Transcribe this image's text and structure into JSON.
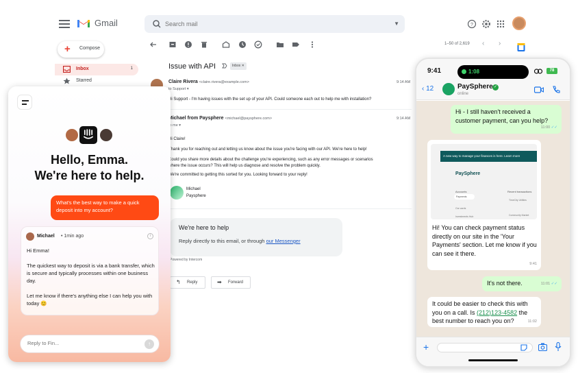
{
  "gmail": {
    "brand": "Gmail",
    "search_placeholder": "Search mail",
    "compose_label": "Compose",
    "nav": [
      {
        "label": "Inbox",
        "count": "1"
      },
      {
        "label": "Starred",
        "count": ""
      }
    ],
    "pager": "1–50 of 2,619",
    "subject": "Issue with API",
    "label_badge": "Inbox ✕",
    "messages": [
      {
        "sender": "Claire Rivera",
        "email": "<claire.rivera@example.com>",
        "to": "to Support ▾",
        "time": "9:14 AM",
        "body": "Hi Support - I'm having issues with the set up of your API. Could someone each out to help me with installation?"
      },
      {
        "sender": "Michael from Paysphere",
        "email": "<michael@paysphere.com>",
        "to": "to me ▾",
        "time": "9:14 AM",
        "greeting": "Hi Claire!",
        "p1": "Thank you for reaching out and letting us know about the issue you're facing with our API. We're here to help!",
        "p2": "Could you share more details about the challenge you're experiencing, such as any error messages or scenarios where the issue occurs? This will help us diagnose and resolve the problem quickly.",
        "p3": "We're committed to getting this sorted for you. Looking forward to your reply!",
        "sig_name": "Michael",
        "sig_company": "Paysphere"
      }
    ],
    "help_title": "We're here to help",
    "help_text": "Reply directly to this email, or through ",
    "help_link": "our Messenger",
    "powered_by": "Powered by Intercom",
    "reply_label": "Reply",
    "forward_label": "Forward"
  },
  "intercom": {
    "greeting_line1": "Hello, Emma.",
    "greeting_line2": "We're here to help.",
    "user_message": "What's the best way to make a quick deposit into my account?",
    "agent_name": "Michael",
    "agent_time": "• 1min ago",
    "agent_p1": "Hi Emma!",
    "agent_p2": "The quickest way to deposit is via a bank transfer, which is secure and typically processes within one business day.",
    "agent_p3": "Let me know if there's anything else I can help you with today 😊",
    "reply_placeholder": "Reply to Fin..."
  },
  "whatsapp": {
    "clock": "9:41",
    "island_time": "1:08",
    "battery": "78",
    "back_count": "12",
    "contact_name": "PaySphere",
    "contact_status": "online",
    "messages": [
      {
        "dir": "out",
        "text": "Hi - I still haven't received a customer payment, can you help?",
        "time": "11:00"
      },
      {
        "dir": "in",
        "shot_banner": "A new way to manage your finances is here. Learn more",
        "shot_logo": "PaySphere",
        "shot_accounts": "Accounts",
        "shot_recent": "Recent transactions",
        "shot_payments": "Payments",
        "shot_item1": "Our cards",
        "shot_item2": "Investments Hub",
        "shot_item3": "TimeCity Utilities",
        "shot_item4": "Community Market",
        "text": "Hi! You can check payment status directly on our site in the 'Your Payments' section. Let me know if you can see it there.",
        "time": "9:41"
      },
      {
        "dir": "out",
        "text": "It's not there.",
        "time": "11:01"
      },
      {
        "dir": "in",
        "text_pre": "It could be easier to check this with you on a call. Is ",
        "phone": "(212)123-4582",
        "text_post": " the best number to reach you on?",
        "time": "11:02"
      }
    ]
  },
  "colors": {
    "gmail_accent": "#c5221f",
    "intercom_bubble": "#ff4a14",
    "whatsapp_out": "#d9fdd3",
    "whatsapp_link": "#1a8f4d"
  }
}
